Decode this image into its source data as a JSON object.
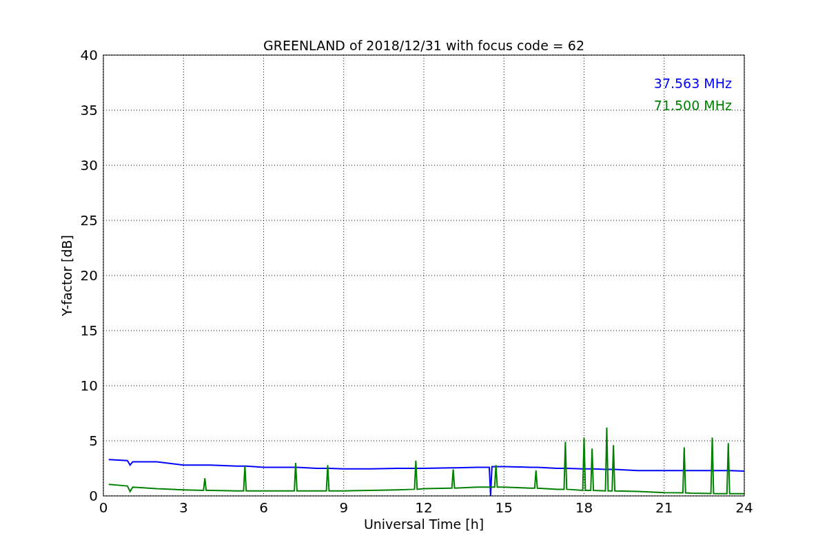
{
  "figure": {
    "chart_data": {
      "type": "line",
      "title": "GREENLAND of 2018/12/31 with focus code = 62",
      "xlabel": "Universal Time [h]",
      "ylabel": "Y-factor [dB]",
      "xlim": [
        0,
        24
      ],
      "ylim": [
        0,
        40
      ],
      "xticks": [
        0,
        3,
        6,
        9,
        12,
        15,
        18,
        21,
        24
      ],
      "yticks": [
        0,
        5,
        10,
        15,
        20,
        25,
        30,
        35,
        40
      ],
      "grid": true,
      "x": [
        0.2,
        0.9,
        1.0,
        1.1,
        2,
        3,
        3.75,
        3.8,
        3.85,
        4,
        5,
        5.25,
        5.3,
        5.35,
        6,
        7,
        7.15,
        7.2,
        7.25,
        8,
        8.35,
        8.4,
        8.45,
        9,
        10,
        11,
        11.65,
        11.7,
        11.75,
        12,
        13,
        13.05,
        13.1,
        13.15,
        14,
        14.45,
        14.5,
        14.55,
        14.65,
        14.7,
        14.75,
        15,
        16,
        16.15,
        16.2,
        16.25,
        17,
        17.25,
        17.3,
        17.35,
        17.95,
        18.0,
        18.05,
        18.25,
        18.3,
        18.35,
        18.8,
        18.85,
        18.9,
        19.05,
        19.1,
        19.15,
        20,
        21,
        21.7,
        21.75,
        21.8,
        22,
        22.75,
        22.8,
        22.85,
        23,
        23.35,
        23.4,
        23.45,
        24
      ],
      "series": [
        {
          "name": "37.563 MHz",
          "color": "#0000ff",
          "values": [
            3.3,
            3.2,
            2.8,
            3.1,
            3.1,
            2.8,
            2.8,
            2.8,
            2.8,
            2.8,
            2.7,
            2.7,
            2.7,
            2.7,
            2.6,
            2.6,
            2.6,
            2.6,
            2.6,
            2.5,
            2.5,
            2.5,
            2.5,
            2.45,
            2.45,
            2.5,
            2.5,
            2.5,
            2.5,
            2.5,
            2.55,
            2.55,
            2.55,
            2.55,
            2.6,
            2.6,
            0,
            2.65,
            2.65,
            2.65,
            2.65,
            2.65,
            2.6,
            2.6,
            2.6,
            2.6,
            2.5,
            2.5,
            2.5,
            2.5,
            2.45,
            2.45,
            2.45,
            2.45,
            2.45,
            2.45,
            2.4,
            2.4,
            2.4,
            2.4,
            2.4,
            2.4,
            2.3,
            2.3,
            2.3,
            2.3,
            2.3,
            2.3,
            2.3,
            2.3,
            2.3,
            2.3,
            2.3,
            2.3,
            2.3,
            2.25
          ]
        },
        {
          "name": "71.500 MHz",
          "color": "#008000",
          "values": [
            1.05,
            0.9,
            0.4,
            0.8,
            0.65,
            0.55,
            0.5,
            1.6,
            0.5,
            0.5,
            0.45,
            0.45,
            2.7,
            0.45,
            0.45,
            0.45,
            0.45,
            3.0,
            0.45,
            0.45,
            0.45,
            2.8,
            0.45,
            0.45,
            0.5,
            0.55,
            0.6,
            3.2,
            0.6,
            0.65,
            0.7,
            0.7,
            2.4,
            0.7,
            0.8,
            0.8,
            0.8,
            0.8,
            0.8,
            2.8,
            0.8,
            0.8,
            0.7,
            0.7,
            2.3,
            0.7,
            0.6,
            0.6,
            4.9,
            0.6,
            0.5,
            5.3,
            0.5,
            0.5,
            4.3,
            0.5,
            0.45,
            6.2,
            0.45,
            0.45,
            4.6,
            0.45,
            0.4,
            0.3,
            0.28,
            4.4,
            0.28,
            0.25,
            0.22,
            5.3,
            0.22,
            0.2,
            0.2,
            4.8,
            0.2,
            0.2
          ]
        }
      ]
    }
  }
}
